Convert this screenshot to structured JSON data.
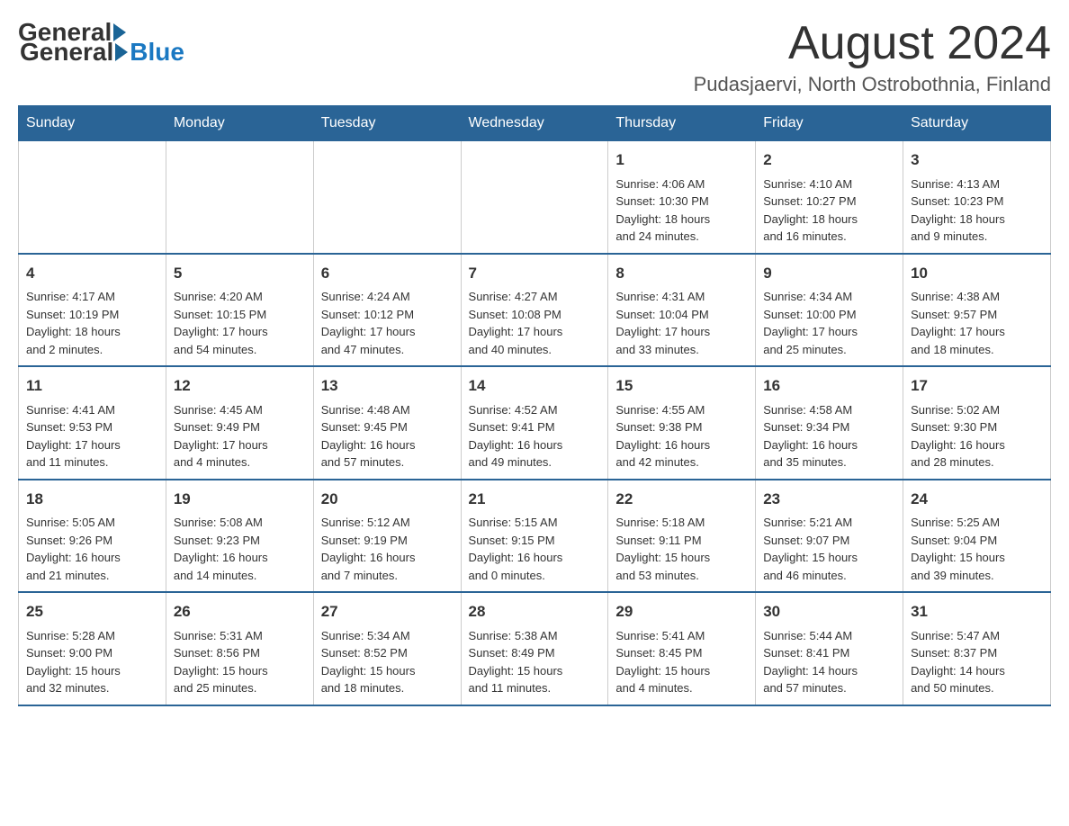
{
  "header": {
    "logo_general": "General",
    "logo_blue": "Blue",
    "month_title": "August 2024",
    "location": "Pudasjaervi, North Ostrobothnia, Finland"
  },
  "days_of_week": [
    "Sunday",
    "Monday",
    "Tuesday",
    "Wednesday",
    "Thursday",
    "Friday",
    "Saturday"
  ],
  "weeks": [
    [
      {
        "day": "",
        "info": ""
      },
      {
        "day": "",
        "info": ""
      },
      {
        "day": "",
        "info": ""
      },
      {
        "day": "",
        "info": ""
      },
      {
        "day": "1",
        "info": "Sunrise: 4:06 AM\nSunset: 10:30 PM\nDaylight: 18 hours\nand 24 minutes."
      },
      {
        "day": "2",
        "info": "Sunrise: 4:10 AM\nSunset: 10:27 PM\nDaylight: 18 hours\nand 16 minutes."
      },
      {
        "day": "3",
        "info": "Sunrise: 4:13 AM\nSunset: 10:23 PM\nDaylight: 18 hours\nand 9 minutes."
      }
    ],
    [
      {
        "day": "4",
        "info": "Sunrise: 4:17 AM\nSunset: 10:19 PM\nDaylight: 18 hours\nand 2 minutes."
      },
      {
        "day": "5",
        "info": "Sunrise: 4:20 AM\nSunset: 10:15 PM\nDaylight: 17 hours\nand 54 minutes."
      },
      {
        "day": "6",
        "info": "Sunrise: 4:24 AM\nSunset: 10:12 PM\nDaylight: 17 hours\nand 47 minutes."
      },
      {
        "day": "7",
        "info": "Sunrise: 4:27 AM\nSunset: 10:08 PM\nDaylight: 17 hours\nand 40 minutes."
      },
      {
        "day": "8",
        "info": "Sunrise: 4:31 AM\nSunset: 10:04 PM\nDaylight: 17 hours\nand 33 minutes."
      },
      {
        "day": "9",
        "info": "Sunrise: 4:34 AM\nSunset: 10:00 PM\nDaylight: 17 hours\nand 25 minutes."
      },
      {
        "day": "10",
        "info": "Sunrise: 4:38 AM\nSunset: 9:57 PM\nDaylight: 17 hours\nand 18 minutes."
      }
    ],
    [
      {
        "day": "11",
        "info": "Sunrise: 4:41 AM\nSunset: 9:53 PM\nDaylight: 17 hours\nand 11 minutes."
      },
      {
        "day": "12",
        "info": "Sunrise: 4:45 AM\nSunset: 9:49 PM\nDaylight: 17 hours\nand 4 minutes."
      },
      {
        "day": "13",
        "info": "Sunrise: 4:48 AM\nSunset: 9:45 PM\nDaylight: 16 hours\nand 57 minutes."
      },
      {
        "day": "14",
        "info": "Sunrise: 4:52 AM\nSunset: 9:41 PM\nDaylight: 16 hours\nand 49 minutes."
      },
      {
        "day": "15",
        "info": "Sunrise: 4:55 AM\nSunset: 9:38 PM\nDaylight: 16 hours\nand 42 minutes."
      },
      {
        "day": "16",
        "info": "Sunrise: 4:58 AM\nSunset: 9:34 PM\nDaylight: 16 hours\nand 35 minutes."
      },
      {
        "day": "17",
        "info": "Sunrise: 5:02 AM\nSunset: 9:30 PM\nDaylight: 16 hours\nand 28 minutes."
      }
    ],
    [
      {
        "day": "18",
        "info": "Sunrise: 5:05 AM\nSunset: 9:26 PM\nDaylight: 16 hours\nand 21 minutes."
      },
      {
        "day": "19",
        "info": "Sunrise: 5:08 AM\nSunset: 9:23 PM\nDaylight: 16 hours\nand 14 minutes."
      },
      {
        "day": "20",
        "info": "Sunrise: 5:12 AM\nSunset: 9:19 PM\nDaylight: 16 hours\nand 7 minutes."
      },
      {
        "day": "21",
        "info": "Sunrise: 5:15 AM\nSunset: 9:15 PM\nDaylight: 16 hours\nand 0 minutes."
      },
      {
        "day": "22",
        "info": "Sunrise: 5:18 AM\nSunset: 9:11 PM\nDaylight: 15 hours\nand 53 minutes."
      },
      {
        "day": "23",
        "info": "Sunrise: 5:21 AM\nSunset: 9:07 PM\nDaylight: 15 hours\nand 46 minutes."
      },
      {
        "day": "24",
        "info": "Sunrise: 5:25 AM\nSunset: 9:04 PM\nDaylight: 15 hours\nand 39 minutes."
      }
    ],
    [
      {
        "day": "25",
        "info": "Sunrise: 5:28 AM\nSunset: 9:00 PM\nDaylight: 15 hours\nand 32 minutes."
      },
      {
        "day": "26",
        "info": "Sunrise: 5:31 AM\nSunset: 8:56 PM\nDaylight: 15 hours\nand 25 minutes."
      },
      {
        "day": "27",
        "info": "Sunrise: 5:34 AM\nSunset: 8:52 PM\nDaylight: 15 hours\nand 18 minutes."
      },
      {
        "day": "28",
        "info": "Sunrise: 5:38 AM\nSunset: 8:49 PM\nDaylight: 15 hours\nand 11 minutes."
      },
      {
        "day": "29",
        "info": "Sunrise: 5:41 AM\nSunset: 8:45 PM\nDaylight: 15 hours\nand 4 minutes."
      },
      {
        "day": "30",
        "info": "Sunrise: 5:44 AM\nSunset: 8:41 PM\nDaylight: 14 hours\nand 57 minutes."
      },
      {
        "day": "31",
        "info": "Sunrise: 5:47 AM\nSunset: 8:37 PM\nDaylight: 14 hours\nand 50 minutes."
      }
    ]
  ]
}
